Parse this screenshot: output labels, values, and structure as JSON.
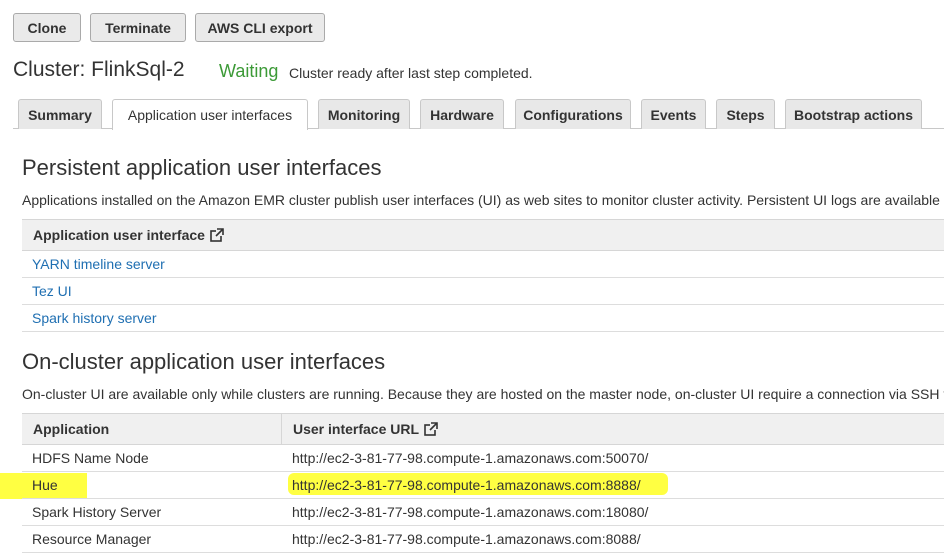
{
  "toolbar": {
    "clone_label": "Clone",
    "terminate_label": "Terminate",
    "cli_export_label": "AWS CLI export"
  },
  "cluster": {
    "title": "Cluster: FlinkSql-2",
    "status": "Waiting",
    "status_message": "Cluster ready after last step completed."
  },
  "tabs": [
    {
      "label": "Summary"
    },
    {
      "label": "Application user interfaces"
    },
    {
      "label": "Monitoring"
    },
    {
      "label": "Hardware"
    },
    {
      "label": "Configurations"
    },
    {
      "label": "Events"
    },
    {
      "label": "Steps"
    },
    {
      "label": "Bootstrap actions"
    }
  ],
  "active_tab": "Application user interfaces",
  "persistent": {
    "title": "Persistent application user interfaces",
    "description": "Applications installed on the Amazon EMR cluster publish user interfaces (UI) as web sites to monitor cluster activity. Persistent UI logs are available",
    "column_header": "Application user interface",
    "rows": [
      {
        "label": "YARN timeline server"
      },
      {
        "label": "Tez UI"
      },
      {
        "label": "Spark history server"
      }
    ]
  },
  "oncluster": {
    "title": "On-cluster application user interfaces",
    "description": "On-cluster UI are available only while clusters are running. Because they are hosted on the master node, on-cluster UI require a connection via SSH tu",
    "headers": {
      "application": "Application",
      "url": "User interface URL"
    },
    "rows": [
      {
        "application": "HDFS Name Node",
        "url": "http://ec2-3-81-77-98.compute-1.amazonaws.com:50070/"
      },
      {
        "application": "Hue",
        "url": "http://ec2-3-81-77-98.compute-1.amazonaws.com:8888/"
      },
      {
        "application": "Spark History Server",
        "url": "http://ec2-3-81-77-98.compute-1.amazonaws.com:18080/"
      },
      {
        "application": "Resource Manager",
        "url": "http://ec2-3-81-77-98.compute-1.amazonaws.com:8088/"
      }
    ]
  },
  "colors": {
    "status_green": "#3c9a37",
    "link_blue": "#1f6fb2",
    "highlight_yellow": "#ffff2e"
  },
  "icons": {
    "external_link": "external-link-icon"
  }
}
